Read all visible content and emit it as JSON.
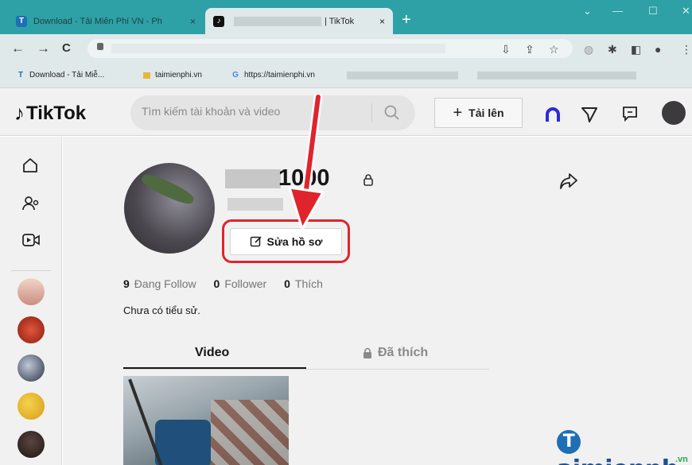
{
  "browser": {
    "tabs": [
      {
        "title": "Download - Tải Miễn Phí VN - Ph",
        "close": "×",
        "active": false,
        "favicon": "T"
      },
      {
        "title": "| TikTok",
        "close": "×",
        "active": true,
        "favicon": "♪"
      }
    ],
    "new_tab": "+",
    "bookmarks": [
      {
        "label": "Download - Tải Miễ...",
        "icon": "T"
      },
      {
        "label": "taimienphi.vn",
        "icon": "folder"
      },
      {
        "label": "https://taimienphi.vn",
        "icon": "G"
      }
    ]
  },
  "tiktok": {
    "logo": "TikTok",
    "search": {
      "placeholder": "Tìm kiếm tài khoản và video"
    },
    "upload_label": "Tải lên",
    "profile": {
      "username": "1000",
      "edit_button": "Sửa hồ sơ",
      "stats": [
        {
          "value": "9",
          "label": "Đang Follow"
        },
        {
          "value": "0",
          "label": "Follower"
        },
        {
          "value": "0",
          "label": "Thích"
        }
      ],
      "bio": "Chưa có tiểu sử.",
      "tabs": {
        "video": "Video",
        "liked": "Đã thích"
      }
    }
  },
  "watermark": {
    "brand": "aimienph",
    "sub": ".vn"
  },
  "colors": {
    "tab_strip": "#2ea1a6",
    "highlight_red": "#e0242c",
    "tiktok_text": "#161616"
  }
}
